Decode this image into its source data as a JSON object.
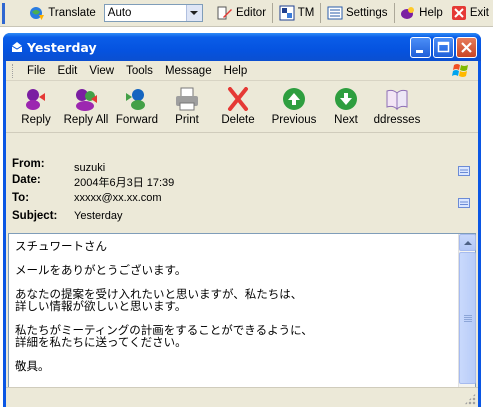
{
  "topbar": {
    "translate_label": "Translate",
    "language_value": "Auto",
    "editor_label": "Editor",
    "tm_label": "TM",
    "settings_label": "Settings",
    "help_label": "Help",
    "exit_label": "Exit"
  },
  "window": {
    "title": "Yesterday"
  },
  "menu": {
    "file": "File",
    "edit": "Edit",
    "view": "View",
    "tools": "Tools",
    "message": "Message",
    "help": "Help"
  },
  "toolbar": {
    "reply": "Reply",
    "reply_all": "Reply All",
    "forward": "Forward",
    "print": "Print",
    "delete": "Delete",
    "previous": "Previous",
    "next": "Next",
    "addresses": "ddresses"
  },
  "headers": {
    "from_label": "From:",
    "from_value": "suzuki",
    "date_label": "Date:",
    "date_value": "2004年6月3日 17:39",
    "to_label": "To:",
    "to_value": "xxxxx@xx.xx.com",
    "subject_label": "Subject:",
    "subject_value": "Yesterday"
  },
  "message": {
    "p1": "スチュワートさん",
    "p2": "メールをありがとうございます。",
    "p3": "あなたの提案を受け入れたいと思いますが、私たちは、\n詳しい情報が欲しいと思います。",
    "p4": "私たちがミーティングの計画をすることができるように、\n詳細を私たちに送ってください。",
    "p5": "敬具。"
  },
  "colors": {
    "titlebar": "#0553e0",
    "chrome": "#ece9d8",
    "close_button": "#c94525"
  }
}
